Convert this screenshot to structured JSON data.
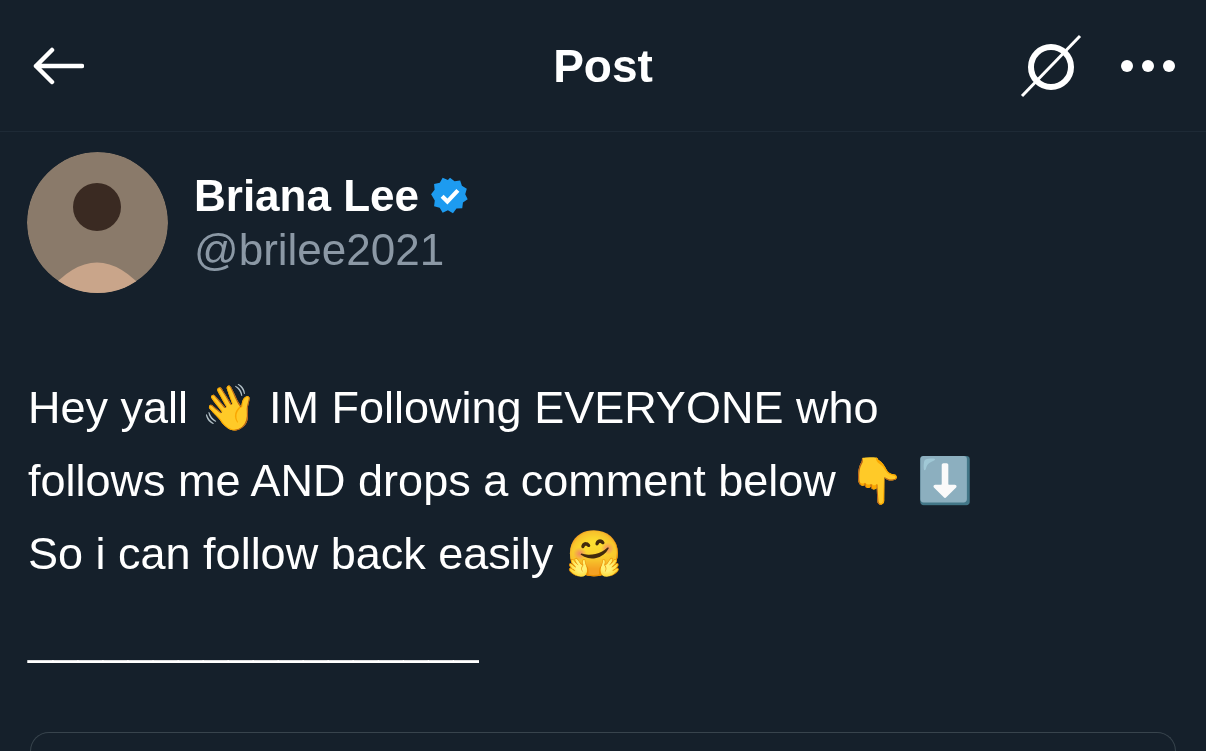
{
  "header": {
    "title": "Post"
  },
  "author": {
    "name": "Briana Lee",
    "verified": true,
    "handle": "@brilee2021"
  },
  "post": {
    "lines": [
      "Hey yall 👋 IM Following EVERYONE who",
      "follows me AND drops a comment below  👇 ⬇️",
      "So i can follow back easily 🤗",
      "__________________"
    ]
  }
}
